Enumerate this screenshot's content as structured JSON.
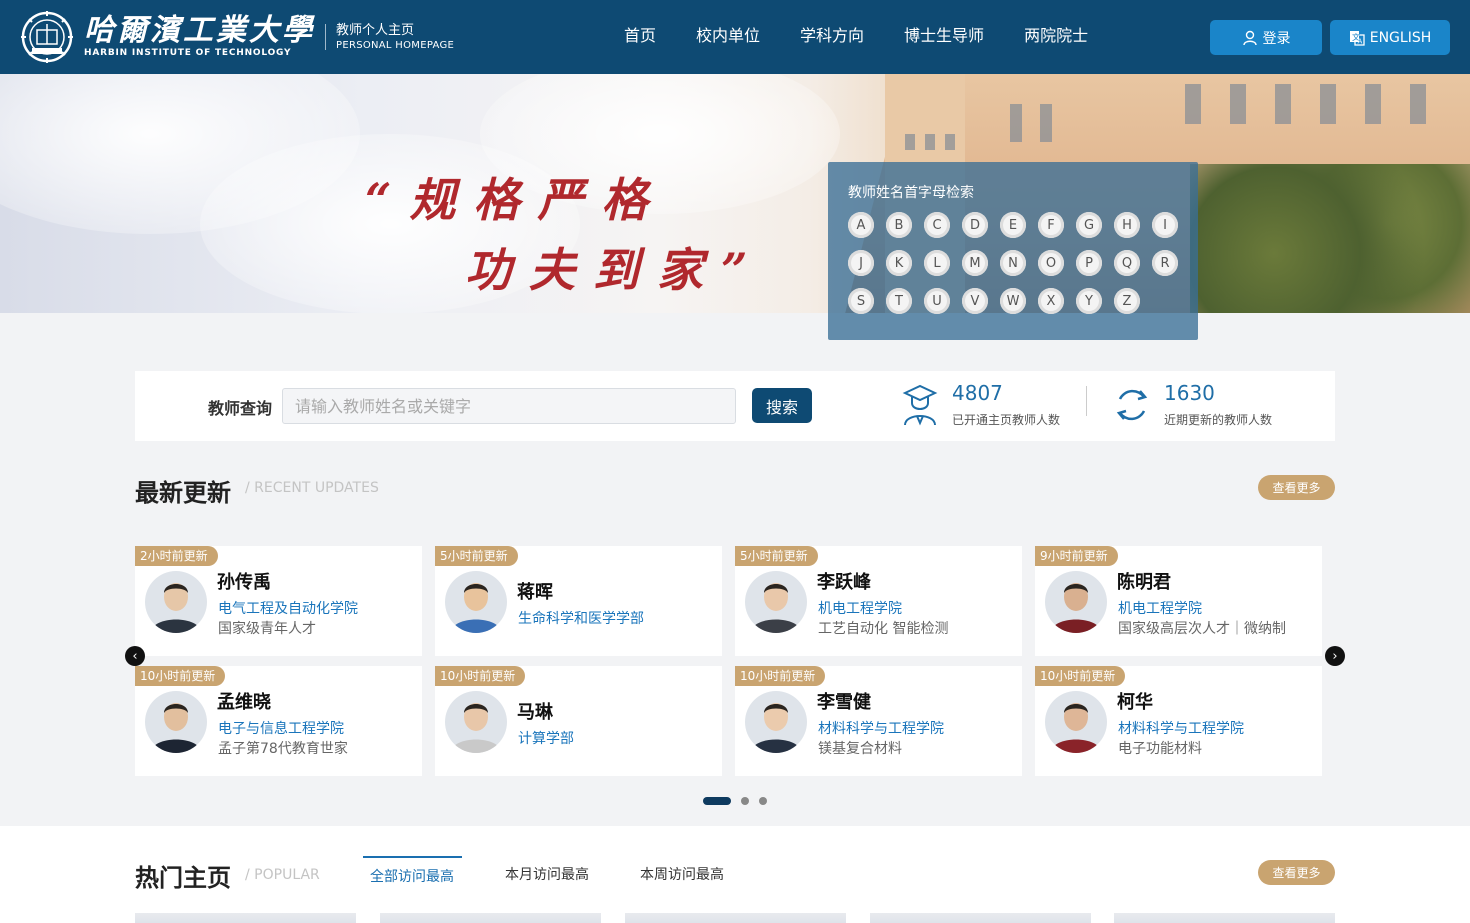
{
  "header": {
    "logo_cn": "哈爾濱工業大學",
    "logo_en": "HARBIN INSTITUTE OF TECHNOLOGY",
    "subtitle_cn": "教师个人主页",
    "subtitle_en": "PERSONAL HOMEPAGE",
    "nav": [
      "首页",
      "校内单位",
      "学科方向",
      "博士生导师",
      "两院院士"
    ],
    "login_label": "登录",
    "english_label": "ENGLISH"
  },
  "banner": {
    "slogan_line1": "“规格严格",
    "slogan_line2": "功夫到家”",
    "alpha_title": "教师姓名首字母检索",
    "letters": [
      "A",
      "B",
      "C",
      "D",
      "E",
      "F",
      "G",
      "H",
      "I",
      "J",
      "K",
      "L",
      "M",
      "N",
      "O",
      "P",
      "Q",
      "R",
      "S",
      "T",
      "U",
      "V",
      "W",
      "X",
      "Y",
      "Z"
    ]
  },
  "search": {
    "label": "教师查询",
    "placeholder": "请输入教师姓名或关键字",
    "button": "搜索",
    "stat1_num": "4807",
    "stat1_label": "已开通主页教师人数",
    "stat2_num": "1630",
    "stat2_label": "近期更新的教师人数"
  },
  "recent": {
    "title": "最新更新",
    "subtitle": "/ RECENT UPDATES",
    "more": "查看更多",
    "cards": [
      {
        "badge": "2小时前更新",
        "name": "孙传禹",
        "dept": "电气工程及自动化学院",
        "note": "国家级青年人才"
      },
      {
        "badge": "5小时前更新",
        "name": "蒋晖",
        "dept": "生命科学和医学学部",
        "note": ""
      },
      {
        "badge": "5小时前更新",
        "name": "李跃峰",
        "dept": "机电工程学院",
        "note": "工艺自动化 智能检测"
      },
      {
        "badge": "9小时前更新",
        "name": "陈明君",
        "dept": "机电工程学院",
        "note": "国家级高层次人才｜微纳制"
      },
      {
        "badge": "10小时前更新",
        "name": "孟维晓",
        "dept": "电子与信息工程学院",
        "note": "孟子第78代教育世家"
      },
      {
        "badge": "10小时前更新",
        "name": "马琳",
        "dept": "计算学部",
        "note": ""
      },
      {
        "badge": "10小时前更新",
        "name": "李雪健",
        "dept": "材料科学与工程学院",
        "note": "镁基复合材料"
      },
      {
        "badge": "10小时前更新",
        "name": "柯华",
        "dept": "材料科学与工程学院",
        "note": "电子功能材料"
      }
    ]
  },
  "popular": {
    "title": "热门主页",
    "subtitle": "/ POPULAR",
    "more": "查看更多",
    "tabs": [
      "全部访问最高",
      "本月访问最高",
      "本周访问最高"
    ]
  },
  "colors": {
    "header_bg": "#0e4a73",
    "accent_blue": "#1a85c9",
    "gold": "#c9a470",
    "link_blue": "#1a75bb"
  }
}
